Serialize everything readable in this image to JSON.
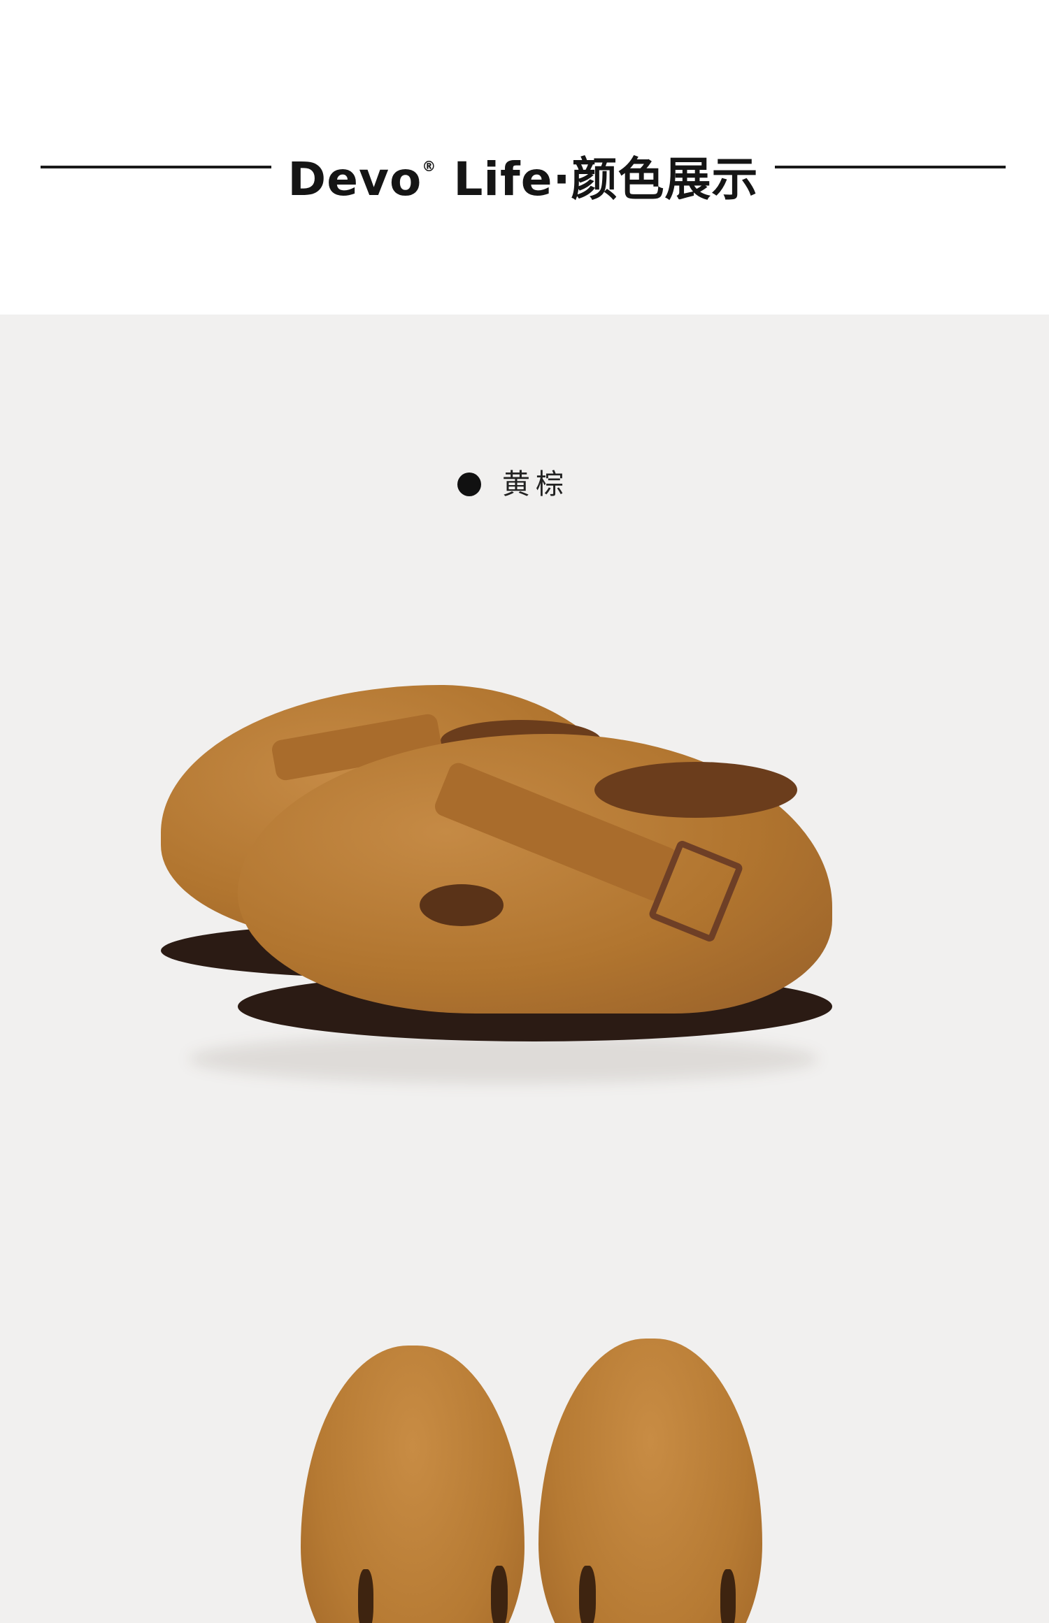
{
  "header": {
    "brand": "Devo",
    "registered_mark": "®",
    "suffix": " Life·颜色展示"
  },
  "color_option": {
    "label": "黄棕"
  },
  "colors": {
    "background": "#ffffff",
    "panel": "#f1f0ef",
    "text": "#151515",
    "suede": "#b1752f",
    "sole": "#2b1b14"
  },
  "images": [
    {
      "name": "shoe-side-view-photo",
      "description": "pair of tan suede clogs with T-strap and metal buckle, side view"
    },
    {
      "name": "shoe-top-view-photo",
      "description": "pair of tan suede clogs, top-down view (cropped)"
    }
  ]
}
